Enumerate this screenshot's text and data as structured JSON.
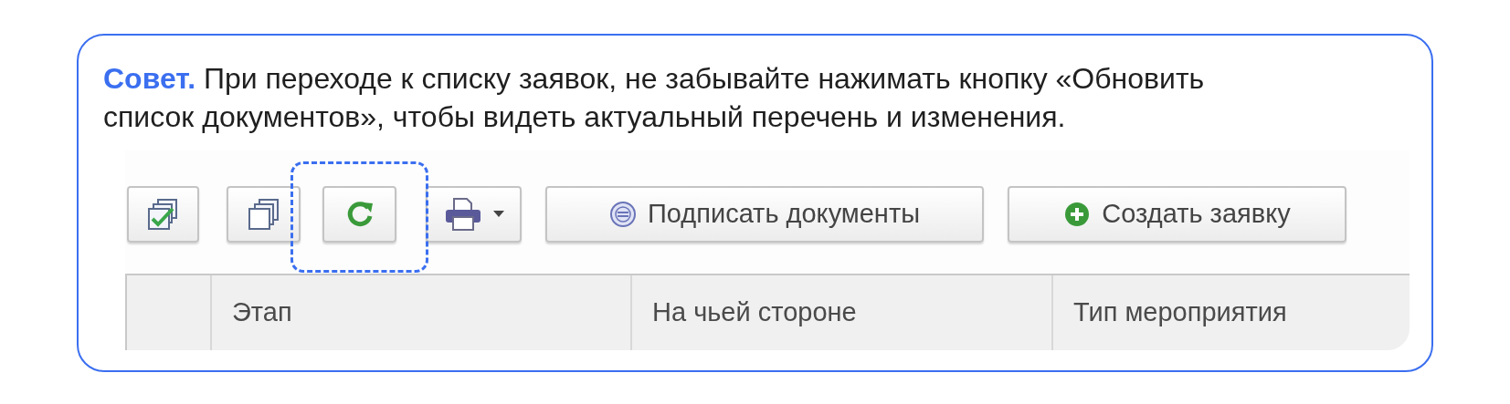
{
  "tip": {
    "text": "**Совет.** При переходе к списку заявок, не забывайте нажимать кнопку «Обновить список документов», чтобы видеть актуальный перечень и изменения."
  },
  "toolbar": [
    {
      "kind": "check_all",
      "highlighted": false
    },
    {
      "kind": "copy",
      "highlighted": false
    },
    {
      "kind": "refresh",
      "highlighted": true
    },
    {
      "kind": "print",
      "highlighted": false
    },
    {
      "kind": "sign",
      "label": "Подписать документы",
      "highlighted": false
    },
    {
      "kind": "create",
      "label": "Создать заявку",
      "highlighted": false
    }
  ],
  "table": {
    "columns": [
      "Этап",
      "На чьей стороне",
      "Тип мероприятия"
    ]
  }
}
